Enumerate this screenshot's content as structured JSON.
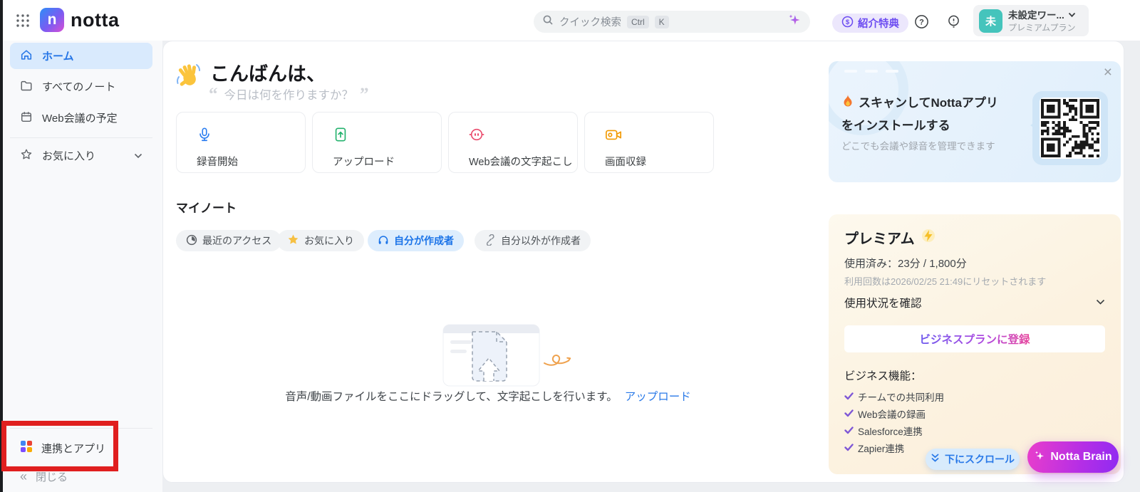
{
  "header": {
    "logo_text": "notta",
    "search_placeholder": "クイック検索",
    "kbd_ctrl": "Ctrl",
    "kbd_k": "K",
    "referral_label": "紹介特典",
    "workspace_name": "未設定ワー...",
    "workspace_plan": "プレミアムプラン",
    "workspace_initial": "未"
  },
  "sidebar": {
    "items": [
      {
        "label": "ホーム",
        "active": true
      },
      {
        "label": "すべてのノート",
        "active": false
      },
      {
        "label": "Web会議の予定",
        "active": false
      },
      {
        "label": "お気に入り",
        "active": false
      }
    ],
    "integrations_label": "連携とアプリ",
    "collapse_label": "閉じる"
  },
  "main": {
    "greeting": "こんばんは、",
    "quote": "今日は何を作りますか？",
    "actions": [
      {
        "label": "録音開始",
        "icon": "mic-icon",
        "color": "#2c7ef0"
      },
      {
        "label": "アップロード",
        "icon": "file-upload-icon",
        "color": "#23b26d"
      },
      {
        "label": "Web会議の文字起こし",
        "icon": "meeting-bot-icon",
        "color": "#ea4c6d"
      },
      {
        "label": "画面収録",
        "icon": "screen-record-icon",
        "color": "#f29900"
      }
    ],
    "my_notes_title": "マイノート",
    "filters": [
      {
        "label": "最近のアクセス",
        "icon": "clock-icon",
        "active": false
      },
      {
        "label": "お気に入り",
        "icon": "star-icon",
        "active": false
      },
      {
        "label": "自分が作成者",
        "icon": "headphones-icon",
        "active": true
      },
      {
        "label": "自分以外が作成者",
        "icon": "link-icon",
        "active": false
      }
    ],
    "empty_caption": "音声/動画ファイルをここにドラッグして、文字起こしを行います。",
    "empty_link": "アップロード"
  },
  "right_panel": {
    "qr_title_line1": "スキャンしてNottaアプリ",
    "qr_title_line2": "をインストールする",
    "qr_subtitle": "どこでも会議や録音を管理できます",
    "premium_title": "プレミアム",
    "usage_label": "使用済み：23分 / 1,800分",
    "reset_note": "利用回数は2026/02/25 21:49にリセットされます",
    "usage_toggle": "使用状況を確認",
    "upgrade_button": "ビジネスプランに登録",
    "features_title": "ビジネス機能：",
    "features": [
      "チームでの共同利用",
      "Web会議の録画",
      "Salesforce連携",
      "Zapier連携"
    ],
    "scroll_down": "下にスクロール",
    "notta_brain": "Notta Brain"
  },
  "icons": {
    "close": "×",
    "collapse_chevron": "«",
    "quote_open": "“",
    "quote_close": "”"
  },
  "colors": {
    "accent_blue": "#2979e8",
    "active_item_bg": "#d9eafd",
    "referral_purple": "#6c4cf1",
    "brain_gradient_start": "#e93ecb",
    "brain_gradient_end": "#8f2bf2",
    "annotation_red": "#e01f1f",
    "avatar_teal": "#45c4bc"
  }
}
